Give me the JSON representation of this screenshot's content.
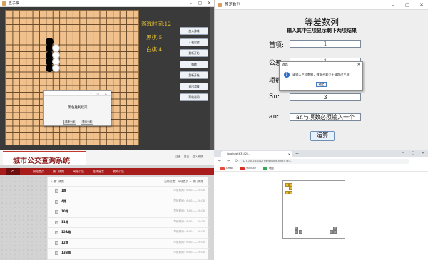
{
  "gomoku": {
    "window_title": "五子棋",
    "game_time_label": "游戏时间:12",
    "black_count_label": "黑棋:5",
    "white_count_label": "白棋:4",
    "buttons": [
      "加入游戏",
      "人机对战",
      "重新开始",
      "悔棋",
      "重新开始",
      "退出游戏",
      "帮助说明"
    ],
    "dialog_message": "黑色胜利结束",
    "dialog_buttons": [
      "再来一局",
      "退出一局"
    ],
    "stones": {
      "black": [
        [
          3,
          2
        ],
        [
          3,
          3
        ],
        [
          3,
          4
        ],
        [
          3,
          5
        ],
        [
          3,
          6
        ]
      ],
      "white": [
        [
          4,
          3
        ],
        [
          4,
          4
        ],
        [
          4,
          5
        ],
        [
          4,
          6
        ]
      ]
    }
  },
  "arith": {
    "window_title": "等差数列",
    "title": "等差数列",
    "subtitle": "输入其中三项显示剩下两项结果",
    "fields": [
      {
        "label": "首项:",
        "value": "1"
      },
      {
        "label": "公差:",
        "value": "1"
      },
      {
        "label": "项数:",
        "value": ""
      },
      {
        "label": "Sn:",
        "value": "3"
      },
      {
        "label": "an:",
        "value": "an与项数必须输入一个"
      }
    ],
    "run_button": "运算",
    "msgbox": {
      "title": "消息",
      "text": "请输入三项数据，数据不要少于或超过三项!",
      "ok": "确定"
    }
  },
  "bus": {
    "site_title": "城市公交查询系统",
    "top_links": [
      "注册",
      "首页",
      "登入系统"
    ],
    "nav_items": [
      "网站首页",
      "热门线路",
      "网站公告",
      "在线留言",
      "我的公告"
    ],
    "breadcrumb": "热门线路",
    "breadcrumb_right": "当前位置：网站首页 > 热门线路",
    "routes": [
      {
        "name": "1路",
        "time": "早班时间：6:00——20:00"
      },
      {
        "name": "4路",
        "time": "早班时间：6:00——20:00"
      },
      {
        "name": "10路",
        "time": "早班时间：7:00——20:00"
      },
      {
        "name": "11路",
        "time": "早班时间：6:00——20:00"
      },
      {
        "name": "12A路",
        "time": "早班时间：6:00——20:00"
      },
      {
        "name": "12路",
        "time": "早班时间：6:00——20:00"
      },
      {
        "name": "13B路",
        "time": "早班时间：6:00——20:00"
      }
    ]
  },
  "browser": {
    "tab_title": "localhost:63342/...",
    "new_tab_symbol": "+",
    "nav_icons": "← → ⟳",
    "url": "127.0.0.1:63342/Tetris/index.html?_ijt=...",
    "bookmarks": [
      {
        "label": "Gmail",
        "color": "#e74c3c"
      },
      {
        "label": "YouTube",
        "color": "#d93025"
      },
      {
        "label": "地图",
        "color": "#34a853"
      }
    ],
    "piece_cells": [
      [
        0,
        0
      ],
      [
        1,
        0
      ],
      [
        1,
        1
      ],
      [
        0,
        2
      ],
      [
        1,
        2
      ]
    ],
    "floor_left_cells": [
      [
        3,
        9
      ],
      [
        3,
        10
      ],
      [
        4,
        10
      ]
    ],
    "floor_right_cells": [
      [
        13,
        9
      ],
      [
        12,
        10
      ],
      [
        13,
        10
      ]
    ]
  },
  "colors": {
    "board": "#f1c18d",
    "game_text": "#e8c230",
    "site_red": "#a81c1c",
    "tetris_gold": "#e8bb3d"
  }
}
